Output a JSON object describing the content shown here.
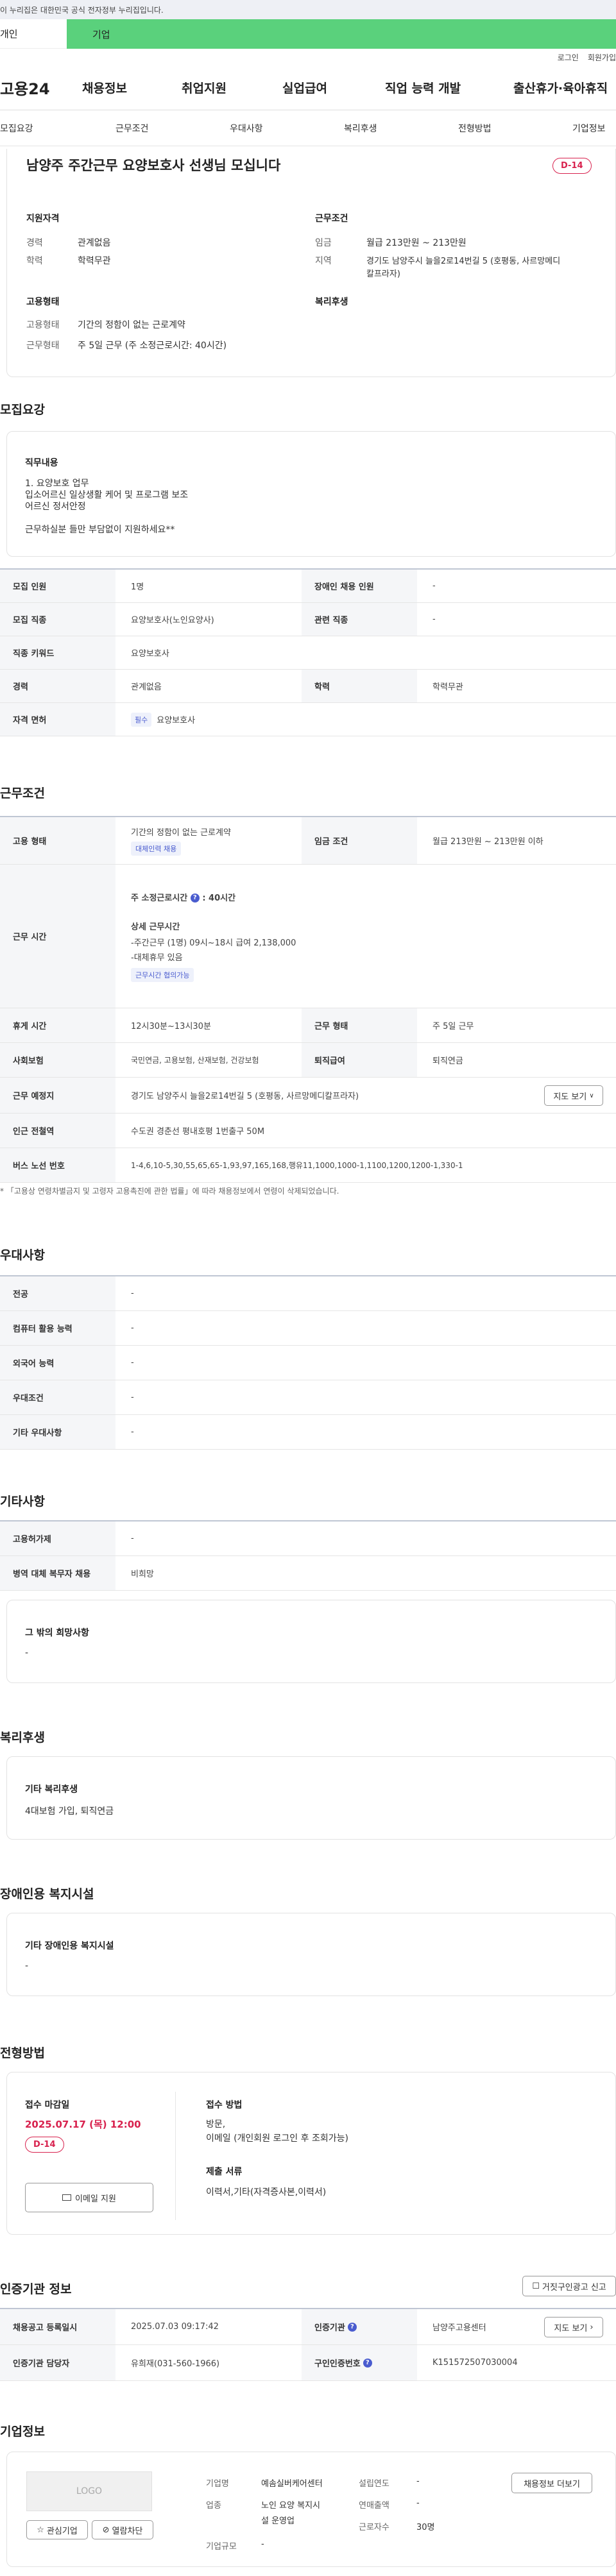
{
  "top_notice": "이 누리집은 대한민국 공식 전자정부 누리집입니다.",
  "user_tabs": {
    "personal": "개인",
    "company": "기업"
  },
  "util": {
    "login": "로그인",
    "signup": "회원가입"
  },
  "logo": "고용24",
  "gnb": [
    "채용정보",
    "취업지원",
    "실업급여",
    "직업 능력 개발",
    "출산휴가·육아휴직"
  ],
  "subnav": [
    "모집요강",
    "근무조건",
    "우대사항",
    "복리후생",
    "전형방법",
    "기업정보"
  ],
  "job": {
    "title": "남양주 주간근무 요양보호사 선생님 모십니다",
    "dday": "D-14",
    "qual_title": "지원자격",
    "career_k": "경력",
    "career_v": "관계없음",
    "edu_k": "학력",
    "edu_v": "학력무관",
    "cond_title": "근무조건",
    "wage_k": "임금",
    "wage_v": "월급 213만원 ~ 213만원",
    "area_k": "지역",
    "area_v1": "경기도 남양주시 늘을2로14번길 5 (호평동, 사르망메디",
    "area_v2": "칼프라자)",
    "emp_title": "고용형태",
    "type_k": "고용형태",
    "type_v": "기간의 정함이 없는 근로계약",
    "worktype_k": "근무형태",
    "worktype_v": "주 5일 근무 (주 소정근로시간: 40시간)",
    "welfare_title": "복리후생"
  },
  "recruit": {
    "section": "모집요강",
    "duty_title": "직무내용",
    "duty_lines": [
      "1. 요양보호 업무",
      "입소어르신 일상생활 케어 및 프로그램 보조",
      "어르신 정서안정",
      "",
      "근무하실분 들만 부담없이 지원하세요**"
    ],
    "rows": [
      [
        "모집 인원",
        "1명",
        "장애인 채용 인원",
        "-"
      ],
      [
        "모집 직종",
        "요양보호사(노인요양사)",
        "관련 직종",
        "-"
      ],
      [
        "직종 키워드",
        "요양보호사",
        "",
        ""
      ],
      [
        "경력",
        "관계없음",
        "학력",
        "학력무관"
      ]
    ],
    "license_k": "자격 면허",
    "license_badge": "필수",
    "license_v": "요양보호사"
  },
  "work": {
    "section": "근무조건",
    "emp_k": "고용 형태",
    "emp_v": "기간의 정함이 없는 근로계약",
    "emp_badge": "대체인력 채용",
    "wage_k": "임금 조건",
    "wage_v": "월급 213만원 ~ 213만원 이하",
    "time_k": "근무 시간",
    "time_weekly": "주 소정근로시간",
    "time_weekly_v": ": 40시간",
    "detail_title": "상세 근무시간",
    "detail_lines": [
      "-주간근무 (1명) 09시~18시 급여 2,138,000",
      "-대체휴무 있음"
    ],
    "time_badge": "근무시간 협의가능",
    "rows": [
      [
        "휴게 시간",
        "12시30분~13시30분",
        "근무 형태",
        "주 5일 근무"
      ],
      [
        "사회보험",
        "국민연금, 고용보험, 산재보험, 건강보험",
        "퇴직급여",
        "퇴직연금"
      ]
    ],
    "place_k": "근무 예정지",
    "place_v": "경기도 남양주시 늘을2로14번길 5 (호평동, 사르망메디칼프라자)",
    "map_btn": "지도 보기",
    "station_k": "인근 전철역",
    "station_v": "수도권 경춘선 평내호평 1번출구 50M",
    "bus_k": "버스 노선 번호",
    "bus_v": "1-4,6,10-5,30,55,65,65-1,93,97,165,168,행유11,1000,1000-1,1100,1200,1200-1,330-1",
    "note": "* 「고용상 연령차별금지 및 고령자 고용촉진에 관한 법률」에 따라 채용정보에서 연령이 삭제되었습니다."
  },
  "prefer": {
    "section": "우대사항",
    "rows": [
      [
        "전공",
        "-"
      ],
      [
        "컴퓨터 활용 능력",
        "-"
      ],
      [
        "외국어 능력",
        "-"
      ],
      [
        "우대조건",
        "-"
      ],
      [
        "기타 우대사항",
        "-"
      ]
    ]
  },
  "etc": {
    "section": "기타사항",
    "rows": [
      [
        "고용허가제",
        "-"
      ],
      [
        "병역 대체 복무자 채용",
        "비희망"
      ]
    ],
    "wish_title": "그 밖의 희망사항",
    "wish_v": "-"
  },
  "welfare": {
    "section": "복리후생",
    "title": "기타 복리후생",
    "v": "4대보험 가입, 퇴직연금"
  },
  "disabled": {
    "section": "장애인용 복지시설",
    "title": "기타 장애인용 복지시설",
    "v": "-"
  },
  "selection": {
    "section": "전형방법",
    "deadline_title": "접수 마감일",
    "deadline_v": "2025.07.17 (목) 12:00",
    "dday": "D-14",
    "email_btn": "이메일 지원",
    "method_title": "접수 방법",
    "method_lines": [
      "방문,",
      "이메일 (개인회원 로그인 후 조회가능)"
    ],
    "docs_title": "제출 서류",
    "docs_v": "이력서,기타(자격증사본,이력서)"
  },
  "cert": {
    "section": "인증기관 정보",
    "report_btn": "거짓구인광고 신고",
    "r1": [
      "채용공고 등록일시",
      "2025.07.03 09:17:42",
      "인증기관",
      "남양주고용센터"
    ],
    "map_btn": "지도 보기",
    "r2": [
      "인증기관 담당자",
      "유희재(031-560-1966)",
      "구인인증번호",
      "K151572507030004"
    ]
  },
  "company": {
    "section": "기업정보",
    "logo_text": "LOGO",
    "fav_btn": "관심기업",
    "block_btn": "열람차단",
    "name_k": "기업명",
    "name_v": "예솜실버케어센터",
    "biz_k": "업종",
    "biz_v1": "노인 요양 복지시",
    "biz_v2": "설 운영업",
    "size_k": "기업규모",
    "size_v": "-",
    "year_k": "설립연도",
    "year_v": "-",
    "sales_k": "연매출액",
    "sales_v": "-",
    "emp_k": "근로자수",
    "emp_v": "30명",
    "jobs_btn": "채용정보 더보기"
  },
  "colors": {
    "accent_green": "#5ad17c",
    "dday_red": "#d8224e",
    "badge_blue": "#4a5ccf"
  }
}
